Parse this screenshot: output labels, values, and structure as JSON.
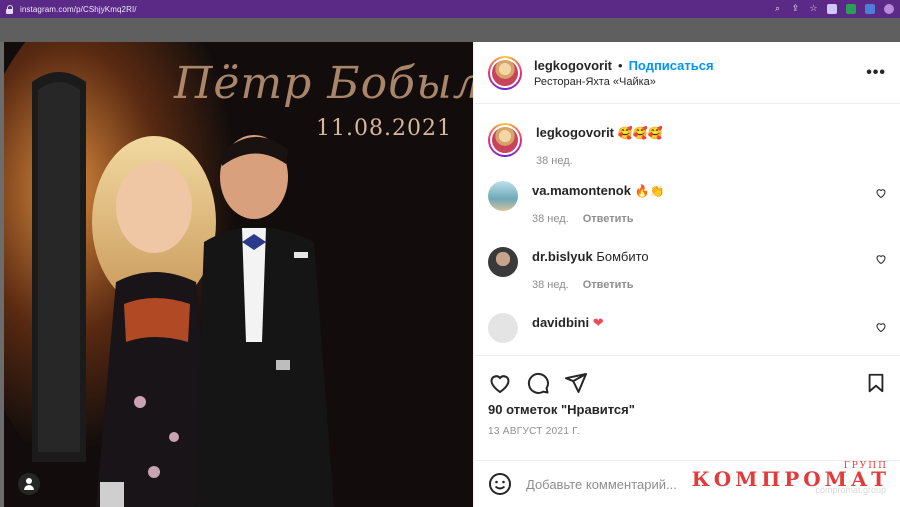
{
  "browser": {
    "url": "instagram.com/p/CShjyKmq2RI/",
    "icons": [
      "search-icon",
      "share-icon",
      "star-icon",
      "extension-icon",
      "profile-icon"
    ]
  },
  "photo": {
    "script_text": "Пётр Бобылё",
    "date_text": "11.08.2021",
    "tag_icon": "user-tag-icon"
  },
  "post": {
    "author": "legkogovorit",
    "separator": "•",
    "follow_label": "Подписаться",
    "location": "Ресторан-Яхта «Чайка»",
    "caption_emoji": "🥰🥰🥰",
    "caption_time": "38 нед.",
    "comments": [
      {
        "user": "va.mamontenok",
        "text": "🔥👏",
        "time": "38 нед.",
        "reply": "Ответить",
        "avatar_color": "#9cc6d8"
      },
      {
        "user": "dr.bislyuk",
        "text": "Бомбито",
        "time": "38 нед.",
        "reply": "Ответить",
        "avatar_color": "#6b6b6b"
      },
      {
        "user": "davidbini",
        "text": "❤",
        "time": "",
        "reply": "",
        "avatar_color": "#dbdbdb"
      }
    ],
    "likes": "90 отметок \"Нравится\"",
    "date": "13 АВГУСТ 2021 Г.",
    "comment_placeholder": "Добавьте комментарий..."
  },
  "watermark": {
    "main": "КОМПРОМАТ",
    "top": "ГРУПП",
    "sub": "compromat.group"
  },
  "colors": {
    "accent": "#0095f6",
    "browser_bar": "#5b2a86",
    "heart": "#ed4956",
    "watermark": "#e23b3b"
  }
}
